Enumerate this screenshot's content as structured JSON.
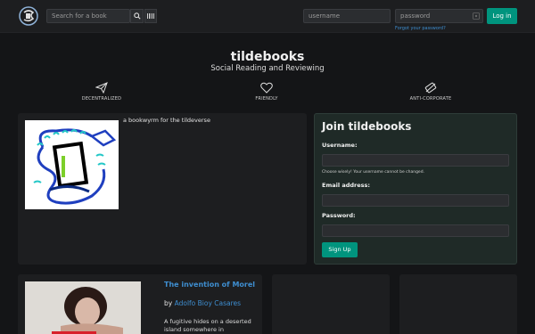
{
  "navbar": {
    "search_placeholder": "Search for a book",
    "username_placeholder": "username",
    "password_placeholder": "password",
    "forgot_label": "Forgot your password?",
    "login_label": "Log in"
  },
  "hero": {
    "title": "tildebooks",
    "subtitle": "Social Reading and Reviewing",
    "features": [
      {
        "label": "DECENTRALIZED",
        "icon": "paper-plane-icon"
      },
      {
        "label": "FRIENDLY",
        "icon": "heart-icon"
      },
      {
        "label": "ANTI-CORPORATE",
        "icon": "no-ticket-icon"
      }
    ]
  },
  "about": {
    "text": "a bookwyrm for the tildeverse"
  },
  "join": {
    "title": "Join tildebooks",
    "username_label": "Username:",
    "username_help": "Choose wisely! Your username cannot be changed.",
    "email_label": "Email address:",
    "password_label": "Password:",
    "signup_label": "Sign Up"
  },
  "book": {
    "title": "The invention of Morel",
    "by": "by ",
    "author": "Adolfo Bioy Casares",
    "description": "A fugitive hides on a deserted island somewhere in"
  },
  "colors": {
    "accent": "#00947e",
    "link": "#3e8ed0",
    "background": "#141517",
    "panel": "#1d1e20"
  }
}
